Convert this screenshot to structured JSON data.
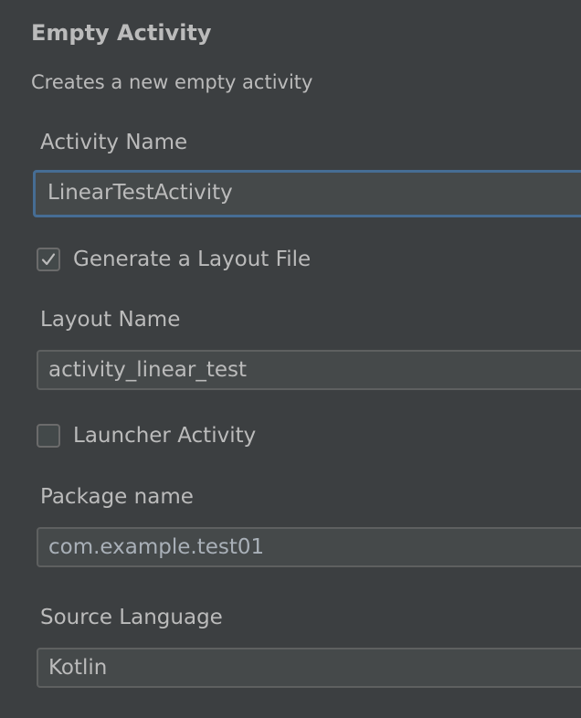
{
  "header": {
    "title": "Empty Activity",
    "description": "Creates a new empty activity"
  },
  "form": {
    "activity_name": {
      "label": "Activity Name",
      "value": "LinearTestActivity"
    },
    "generate_layout_file": {
      "label": "Generate a Layout File",
      "checked": true
    },
    "layout_name": {
      "label": "Layout Name",
      "value": "activity_linear_test"
    },
    "launcher_activity": {
      "label": "Launcher Activity",
      "checked": false
    },
    "package_name": {
      "label": "Package name",
      "value": "com.example.test01"
    },
    "source_language": {
      "label": "Source Language",
      "value": "Kotlin"
    }
  },
  "colors": {
    "background": "#3c3f41",
    "text": "#bbbbbb",
    "field_background": "#45494a",
    "focus_border": "#466d94"
  },
  "icons": {
    "checkbox_checked": "checkmark-icon"
  }
}
